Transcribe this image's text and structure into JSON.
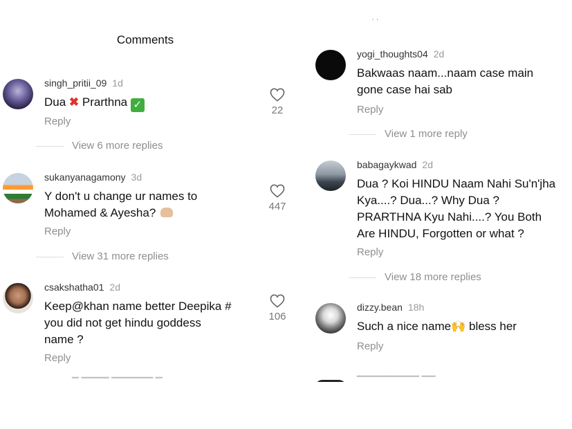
{
  "left": {
    "title": "Comments",
    "comments": [
      {
        "username": "singh_pritii_09",
        "time": "1d",
        "text_before": "Dua",
        "text_mid": "Prarthna",
        "reply_label": "Reply",
        "likes": "22",
        "view_more": "View 6 more replies"
      },
      {
        "username": "sukanyanagamony",
        "time": "3d",
        "text_line1": "Y don't u change ur names to",
        "text_line2": "Mohamed & Ayesha?",
        "reply_label": "Reply",
        "likes": "447",
        "view_more": "View 31 more replies"
      },
      {
        "username": "csakshatha01",
        "time": "2d",
        "text_line1": "Keep@khan name  better Deepika #",
        "text_line2": "you did not get hindu goddess",
        "text_line3": "name ?",
        "reply_label": "Reply",
        "likes": "106"
      }
    ]
  },
  "right": {
    "comments": [
      {
        "username": "yogi_thoughts04",
        "time": "2d",
        "text_line1": "Bakwaas naam...naam case main",
        "text_line2": "gone case hai sab",
        "reply_label": "Reply",
        "view_more": "View 1 more reply"
      },
      {
        "username": "babagaykwad",
        "time": "2d",
        "text_line1": "Dua ? Koi HINDU Naam Nahi Su'n'jha",
        "text_line2": "Kya....? Dua...? Why Dua ?",
        "text_line3": "PRARTHNA Kyu Nahi....? You Both",
        "text_line4": "Are HINDU, Forgotten or what ?",
        "reply_label": "Reply",
        "view_more": "View 18 more replies"
      },
      {
        "username": "dizzy.bean",
        "time": "18h",
        "text_before": "Such a nice name",
        "text_after": " bless her",
        "reply_label": "Reply"
      }
    ]
  },
  "icons": {
    "like": "heart-outline-icon",
    "cross": "cross-mark-emoji",
    "check": "check-mark-emoji",
    "clap": "raising-hands-emoji",
    "folded": "folded-hands-emoji"
  },
  "colors": {
    "text": "#111111",
    "muted": "#8e8e8e",
    "cross": "#e0302a",
    "check": "#3fae3f"
  }
}
